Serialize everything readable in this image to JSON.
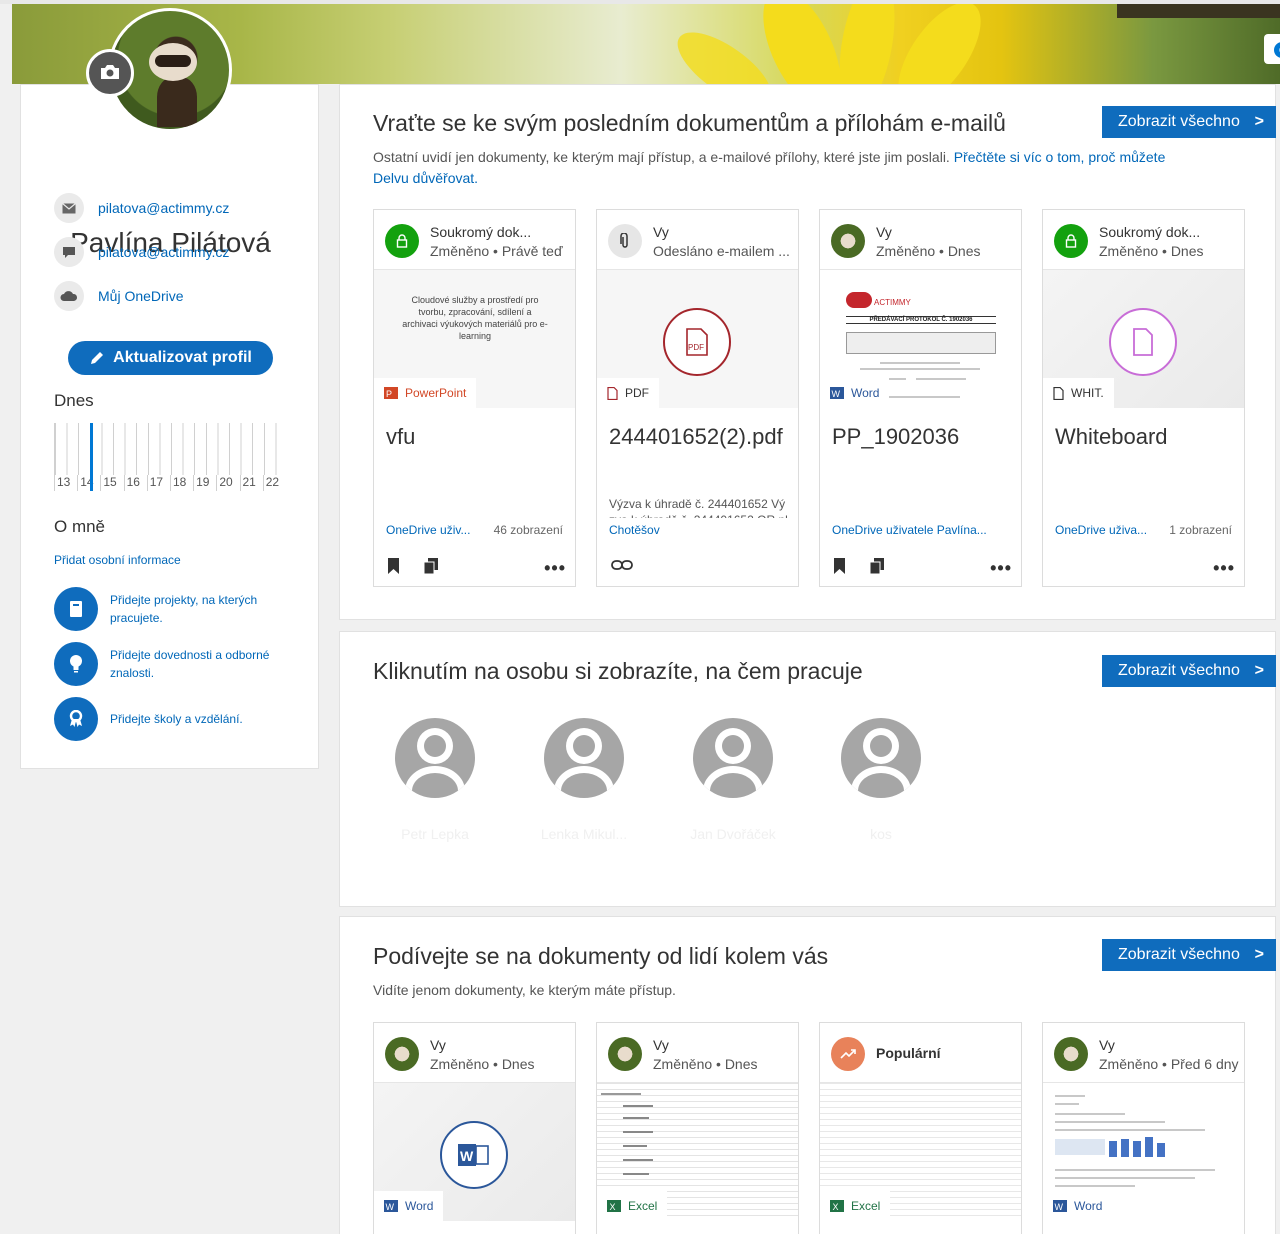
{
  "profile": {
    "name": "Pavlína Pilátová",
    "email": "pilatova@actimmy.cz",
    "chat": "pilatova@actimmy.cz",
    "onedrive": "Můj OneDrive",
    "update_button": "Aktualizovat profil",
    "today_label": "Dnes",
    "timeline_days": [
      "13",
      "14",
      "15",
      "16",
      "17",
      "18",
      "19",
      "20",
      "21",
      "22"
    ],
    "about_title": "O mně",
    "add_info": "Přidat osobní informace",
    "suggestions": [
      {
        "icon": "notebook-icon",
        "text": "Přidejte projekty, na kterých pracujete."
      },
      {
        "icon": "lightbulb-icon",
        "text": "Přidejte dovednosti a odborné znalosti."
      },
      {
        "icon": "ribbon-icon",
        "text": "Přidejte školy a vzdělání."
      }
    ]
  },
  "recent": {
    "title": "Vraťte se ke svým posledním dokumentům a přílohám e-mailů",
    "subtitle": "Ostatní uvidí jen dokumenty, ke kterým mají přístup, a e-mailové přílohy, které jste jim poslali. ",
    "subtitle_link": "Přečtěte si víc o tom, proč můžete Delvu důvěřovat.",
    "show_all": "Zobrazit všechno",
    "cards": [
      {
        "header1": "Soukromý dok...",
        "header2": "Změněno • Právě teď",
        "type": "PowerPoint",
        "type_color": "#d24726",
        "name": "vfu",
        "location": "OneDrive uživ...",
        "views": "46 zobrazení",
        "preview_text": "Cloudové služby a prostředí pro tvorbu, zpracování, sdílení a archivaci výukových materiálů pro e-learning"
      },
      {
        "header1": "Vy",
        "header2": "Odesláno e-mailem ...",
        "type": "PDF",
        "type_color": "#333333",
        "name": "244401652(2).pdf",
        "snippet": "Výzva k úhradě č. 244401652 Vý zva k úhradě č. 244401652 QR pl",
        "snippet_from": "Chotěšov"
      },
      {
        "header1": "Vy",
        "header2": "Změněno • Dnes",
        "type": "Word",
        "type_color": "#2b579a",
        "name": "PP_1902036",
        "location": "OneDrive uživatele Pavlína...",
        "preview_title": "PŘEDÁVACÍ PROTOKOL Č. 1902036",
        "preview_brand": "ACTIMMY"
      },
      {
        "header1": "Soukromý dok...",
        "header2": "Změněno • Dnes",
        "type": "WHIT.",
        "type_color": "#333333",
        "name": "Whiteboard",
        "location": "OneDrive uživa...",
        "views": "1 zobrazení"
      }
    ]
  },
  "people": {
    "title": "Kliknutím na osobu si zobrazíte, na čem pracuje",
    "show_all": "Zobrazit všechno",
    "persons": [
      "Petr Lepka",
      "Lenka Mikul...",
      "Jan Dvořáček",
      "kos"
    ]
  },
  "around": {
    "title": "Podívejte se na dokumenty od lidí kolem vás",
    "subtitle": "Vidíte jenom dokumenty, ke kterým máte přístup.",
    "show_all": "Zobrazit všechno",
    "cards": [
      {
        "header1": "Vy",
        "header2": "Změněno • Dnes",
        "type": "Word",
        "type_color": "#2b579a"
      },
      {
        "header1": "Vy",
        "header2": "Změněno • Dnes",
        "type": "Excel",
        "type_color": "#217346"
      },
      {
        "header1": "Populární",
        "header2": "",
        "type": "Excel",
        "type_color": "#217346"
      },
      {
        "header1": "Vy",
        "header2": "Změněno • Před 6 dny",
        "type": "Word",
        "type_color": "#2b579a"
      }
    ]
  },
  "colors": {
    "accent": "#0f6cbd",
    "link": "#0067b8",
    "private_badge": "#13a10e",
    "popular_badge": "#e8825a"
  }
}
